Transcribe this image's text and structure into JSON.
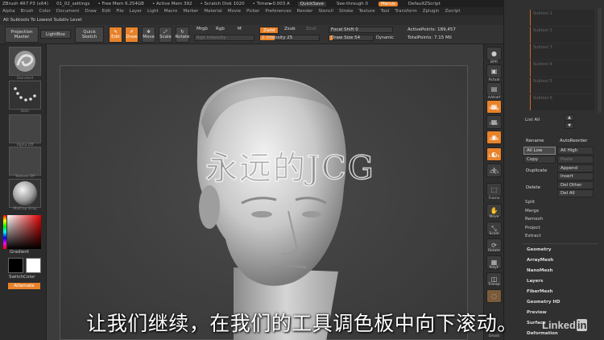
{
  "titlebar": {
    "app": "ZBrush 4R7 P3 (x64)",
    "doc": "01_02_settings",
    "free_mem": "• Free Mem 6.254GB",
    "active_mem": "• Active Mem 392",
    "scratch": "• Scratch Disk 1020",
    "timer": "• Timer►0.003 A",
    "quicksave": "QuickSave",
    "see_through": "See-through  0",
    "menus": "Menus",
    "default_script": "DefaultZScript"
  },
  "menubar": [
    "Alpha",
    "Brush",
    "Color",
    "Document",
    "Draw",
    "Edit",
    "File",
    "Layer",
    "Light",
    "Macro",
    "Marker",
    "Material",
    "Movie",
    "Picker",
    "Preferences",
    "Render",
    "Stencil",
    "Stroke",
    "Texture",
    "Tool",
    "Transform",
    "Zplugin",
    "Zscript"
  ],
  "subtools_text": "All Subtools To Lowest Subdiv Level",
  "toolbar": {
    "projection_master": "Projection Master",
    "lightbox": "LightBox",
    "quick_sketch": "Quick Sketch",
    "edit": "Edit",
    "draw": "Draw",
    "move": "Move",
    "scale": "Scale",
    "rotate": "Rotate",
    "mrgb": "Mrgb",
    "rgb": "Rgb",
    "m": "M",
    "rgb_intensity": "Rgb Intensity",
    "zadd": "Zadd",
    "zsub": "Zsub",
    "zcut": "Zcut",
    "z_intensity_label": "Z Intensity",
    "z_intensity": "25",
    "focal_shift_label": "Focal Shift",
    "focal_shift": "0",
    "draw_size_label": "Draw Size",
    "draw_size": "54",
    "dynamic": "Dynamic",
    "active_points": "ActivePoints: 189,457",
    "total_points": "TotalPoints: 7.15 Mil"
  },
  "left_shelf": {
    "brush": "Standard",
    "stroke": "Dots",
    "alpha": "Alpha Off",
    "texture": "Texture Off",
    "material": "MatCap Gray",
    "gradient": "Gradient",
    "switch_color": "SwitchColor",
    "alternate": "Alternate"
  },
  "right_shelf": [
    "BPR",
    "Actual",
    "AAHalf",
    "Persp",
    "Floor",
    "Local",
    "L.Sym",
    "Gxyz",
    "Frame",
    "Move",
    "Scale",
    "Rotate",
    "PolyF",
    "Transp",
    "Ghost"
  ],
  "palette": {
    "ghost_rows": [
      "Subtool 1",
      "Subtool 2",
      "Subtool 3",
      "Subtool 4",
      "Subtool 5",
      "Subtool 6"
    ],
    "list_all": "List All",
    "rename": "Rename",
    "auto_reorder": "AutoReorder",
    "all_low": "All Low",
    "all_high": "All High",
    "copy": "Copy",
    "paste": "Paste",
    "append": "Append",
    "duplicate": "Duplicate",
    "insert": "Insert",
    "del_other": "Del Other",
    "delete": "Delete",
    "del_all": "Del All",
    "split": "Split",
    "merge": "Merge",
    "remesh": "Remesh",
    "project": "Project",
    "extract": "Extract",
    "subpalettes": [
      "Geometry",
      "ArrayMesh",
      "NanoMesh",
      "Layers",
      "FiberMesh",
      "Geometry HD",
      "Preview",
      "Surface",
      "Deformation"
    ]
  },
  "overlay": {
    "watermark": "永远的JCG",
    "subtitle": "让我们继续，在我们的工具调色板中向下滚动。",
    "brand": "Linked",
    "brand_in": "in"
  },
  "colors": {
    "accent": "#e8822a",
    "bg": "#2a2a2a"
  }
}
